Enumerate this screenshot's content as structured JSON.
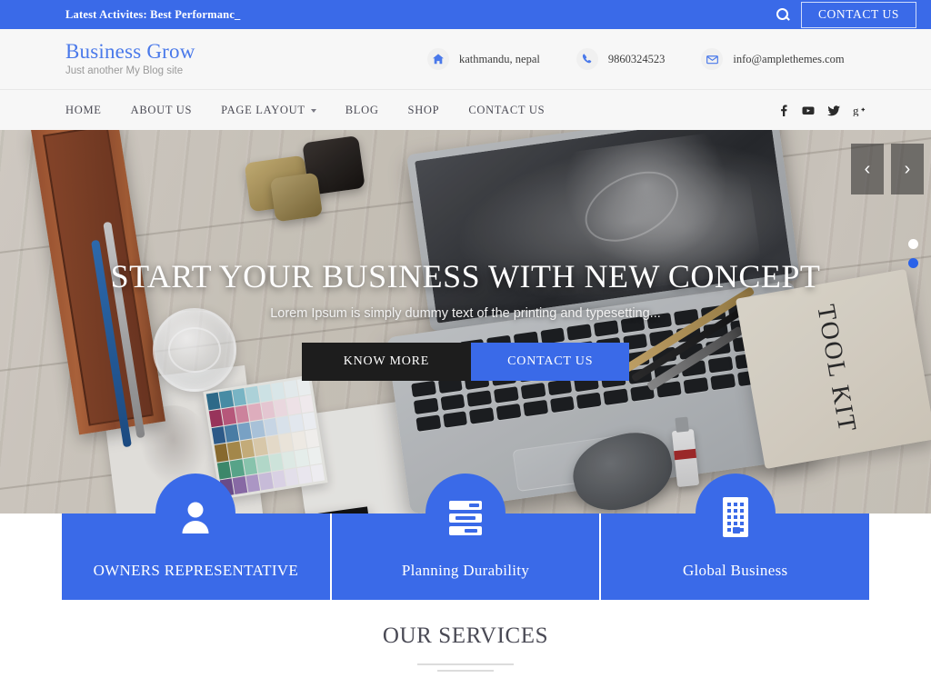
{
  "topbar": {
    "news_label": "Latest Activites:",
    "news_text": " Best Performanc_",
    "search_icon": "search-icon",
    "contact_button": "CONTACT US"
  },
  "header": {
    "logo_title": "Business Grow",
    "logo_tagline": "Just another My Blog site",
    "contacts": [
      {
        "icon": "home-icon",
        "text": "kathmandu, nepal"
      },
      {
        "icon": "phone-icon",
        "text": "9860324523"
      },
      {
        "icon": "envelope-icon",
        "text": "info@amplethemes.com"
      }
    ]
  },
  "nav": {
    "items": [
      {
        "label": "HOME",
        "has_dropdown": false
      },
      {
        "label": "ABOUT US",
        "has_dropdown": false
      },
      {
        "label": "PAGE LAYOUT",
        "has_dropdown": true
      },
      {
        "label": "BLOG",
        "has_dropdown": false
      },
      {
        "label": "SHOP",
        "has_dropdown": false
      },
      {
        "label": "CONTACT US",
        "has_dropdown": false
      }
    ],
    "social": [
      "facebook-icon",
      "youtube-icon",
      "twitter-icon",
      "googleplus-icon"
    ]
  },
  "hero": {
    "title": "START YOUR BUSINESS WITH NEW CONCEPT",
    "subtitle": "Lorem Ipsum is simply dummy text of the printing and typesetting...",
    "button_primary": "KNOW MORE",
    "button_secondary": "CONTACT US",
    "prev_arrow": "‹",
    "next_arrow": "›",
    "dots": [
      {
        "state": "inactive"
      },
      {
        "state": "active"
      }
    ],
    "photo_text": "TOOL KIT"
  },
  "service_boxes": [
    {
      "icon": "user-icon",
      "title": "OWNERS REPRESENTATIVE"
    },
    {
      "icon": "server-bars-icon",
      "title": "Planning Durability"
    },
    {
      "icon": "building-icon",
      "title": "Global Business"
    }
  ],
  "services_section": {
    "title": "OUR SERVICES"
  },
  "colors": {
    "brand_blue": "#3a6ae8",
    "topbar_blue": "#3a6ae8",
    "header_bg": "#f7f7f7",
    "dark_button": "#1d1d1d",
    "nav_text": "#4b4b55",
    "logo_blue": "#4a79ea"
  }
}
